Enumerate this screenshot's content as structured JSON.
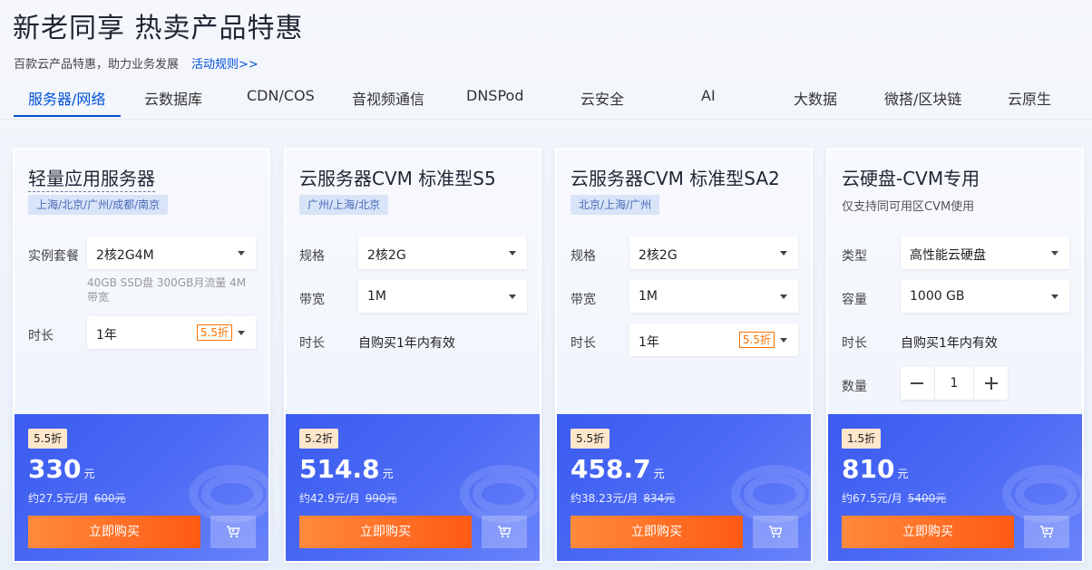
{
  "header": {
    "title": "新老同享 热卖产品特惠",
    "subtitle": "百款云产品特惠，助力业务发展",
    "rules_link": "活动规则>>"
  },
  "tabs": [
    {
      "label": "服务器/网络",
      "active": true
    },
    {
      "label": "云数据库"
    },
    {
      "label": "CDN/COS"
    },
    {
      "label": "音视频通信"
    },
    {
      "label": "DNSPod"
    },
    {
      "label": "云安全"
    },
    {
      "label": "AI"
    },
    {
      "label": "大数据"
    },
    {
      "label": "微搭/区块链"
    },
    {
      "label": "云原生"
    }
  ],
  "cards": [
    {
      "title": "轻量应用服务器",
      "region": "上海/北京/广州/成都/南京",
      "row1_label": "实例套餐",
      "row1_value": "2核2G4M",
      "row1_note": "40GB SSD盘 300GB月流量 4M带宽",
      "row2_label": "时长",
      "row2_value": "1年",
      "row2_discount": "5.5折",
      "badge": "5.5折",
      "price": "330",
      "unit": "元",
      "monthly": "约27.5元/月",
      "original": "600元",
      "buy_label": "立即购买"
    },
    {
      "title": "云服务器CVM 标准型S5",
      "region": "广州/上海/北京",
      "row1_label": "规格",
      "row1_value": "2核2G",
      "row2_label": "带宽",
      "row2_value": "1M",
      "row3_label": "时长",
      "row3_value": "自购买1年内有效",
      "badge": "5.2折",
      "price": "514.8",
      "unit": "元",
      "monthly": "约42.9元/月",
      "original": "990元",
      "buy_label": "立即购买"
    },
    {
      "title": "云服务器CVM 标准型SA2",
      "region": "北京/上海/广州",
      "row1_label": "规格",
      "row1_value": "2核2G",
      "row2_label": "带宽",
      "row2_value": "1M",
      "row3_label": "时长",
      "row3_value": "1年",
      "row3_discount": "5.5折",
      "badge": "5.5折",
      "price": "458.7",
      "unit": "元",
      "monthly": "约38.23元/月",
      "original": "834元",
      "buy_label": "立即购买"
    },
    {
      "title": "云硬盘-CVM专用",
      "desc": "仅支持同可用区CVM使用",
      "row1_label": "类型",
      "row1_value": "高性能云硬盘",
      "row2_label": "容量",
      "row2_value": "1000 GB",
      "row3_label": "时长",
      "row3_value": "自购买1年内有效",
      "row4_label": "数量",
      "quantity": "1",
      "badge": "1.5折",
      "price": "810",
      "unit": "元",
      "monthly": "约67.5元/月",
      "original": "5400元",
      "buy_label": "立即购买"
    }
  ],
  "colors": {
    "accent": "#0052d9",
    "panel": "#4e6cf5",
    "buy": "#ff6a1e",
    "discount": "#ff7200"
  },
  "icons": {
    "cart": "cart-icon",
    "caret": "chevron-down-icon"
  }
}
